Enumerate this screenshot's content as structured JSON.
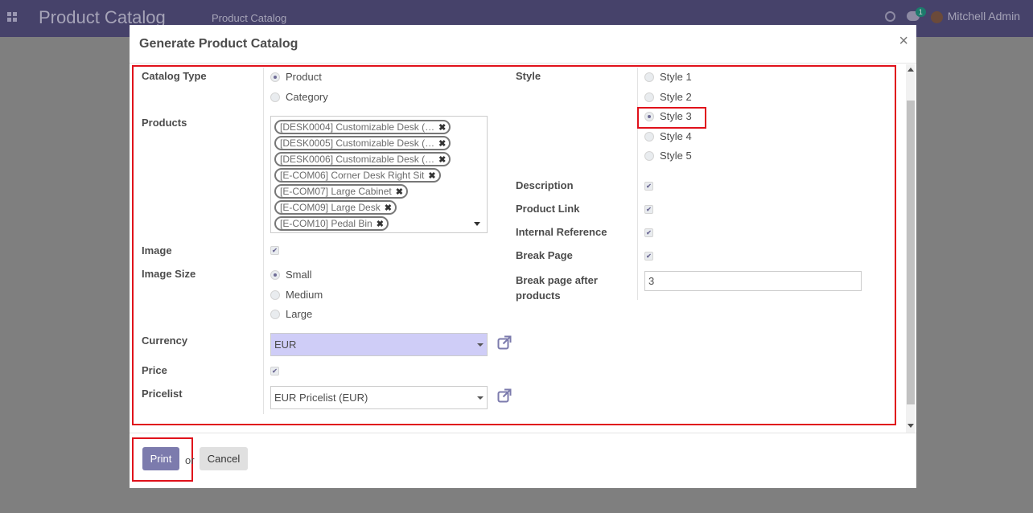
{
  "navbar": {
    "brand": "Product Catalog",
    "menu": "Product Catalog",
    "message_count": "1",
    "user": "Mitchell Admin"
  },
  "modal": {
    "title": "Generate Product Catalog",
    "close": "×"
  },
  "form": {
    "catalog_type": {
      "label": "Catalog Type",
      "options": [
        "Product",
        "Category"
      ],
      "selected": "Product"
    },
    "products": {
      "label": "Products",
      "tags": [
        "[DESK0004] Customizable Desk (…",
        "[DESK0005] Customizable Desk (…",
        "[DESK0006] Customizable Desk (…",
        "[E-COM06] Corner Desk Right Sit",
        "[E-COM07] Large Cabinet",
        "[E-COM09] Large Desk",
        "[E-COM10] Pedal Bin"
      ],
      "remove_glyph": "✖"
    },
    "image": {
      "label": "Image",
      "checked": true
    },
    "image_size": {
      "label": "Image Size",
      "options": [
        "Small",
        "Medium",
        "Large"
      ],
      "selected": "Small"
    },
    "currency": {
      "label": "Currency",
      "value": "EUR",
      "highlight_color": "#cfcdf7"
    },
    "price": {
      "label": "Price",
      "checked": true
    },
    "pricelist": {
      "label": "Pricelist",
      "value": "EUR Pricelist (EUR)"
    },
    "style": {
      "label": "Style",
      "options": [
        "Style 1",
        "Style 2",
        "Style 3",
        "Style 4",
        "Style 5"
      ],
      "selected": "Style 3"
    },
    "description": {
      "label": "Description",
      "checked": true
    },
    "product_link": {
      "label": "Product Link",
      "checked": true
    },
    "internal_reference": {
      "label": "Internal Reference",
      "checked": true
    },
    "break_page": {
      "label": "Break Page",
      "checked": true
    },
    "break_page_after": {
      "label_line1": "Break page after",
      "label_line2": "products",
      "value": "3"
    }
  },
  "footer": {
    "print": "Print",
    "or": "or",
    "cancel": "Cancel"
  },
  "colors": {
    "primary": "#7c7bad",
    "highlight_red": "#e0111b",
    "navbar": "#46426a"
  }
}
